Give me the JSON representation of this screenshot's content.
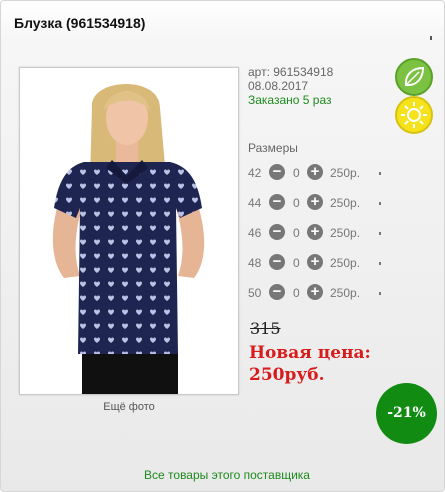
{
  "product": {
    "title": "Блузка (961534918)",
    "more_photos": "Ещё фото",
    "article": "арт: 961534918",
    "date": "08.08.2017",
    "ordered": "Заказано 5 раз",
    "sizes_title": "Размеры",
    "sizes": [
      {
        "size": "42",
        "qty": "0",
        "price": "250р."
      },
      {
        "size": "44",
        "qty": "0",
        "price": "250р."
      },
      {
        "size": "46",
        "qty": "0",
        "price": "250р."
      },
      {
        "size": "48",
        "qty": "0",
        "price": "250р."
      },
      {
        "size": "50",
        "qty": "0",
        "price": "250р."
      }
    ],
    "old_price": "315",
    "new_price_label": "Новая цена:",
    "new_price": "250руб.",
    "discount": "-21%",
    "supplier_link": "Все товары этого поставщика"
  },
  "badges": [
    "leaf-icon",
    "sun-icon"
  ],
  "colors": {
    "accent_green": "#1d8a1d",
    "price_red": "#d81b1b",
    "discount_bg": "#118b11"
  }
}
